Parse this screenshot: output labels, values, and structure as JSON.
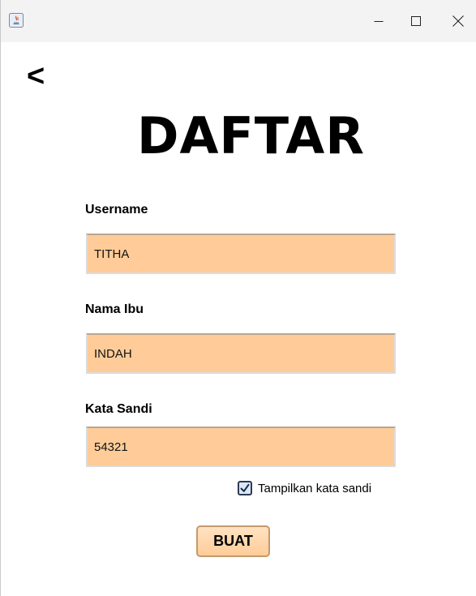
{
  "window": {
    "app_icon": "java-icon",
    "controls": {
      "minimize": "—",
      "maximize": "☐",
      "close": "✕"
    }
  },
  "nav": {
    "back_label": "<"
  },
  "title": "DAFTAR",
  "form": {
    "username": {
      "label": "Username",
      "value": "TITHA"
    },
    "mother_name": {
      "label": "Nama Ibu",
      "value": "INDAH"
    },
    "password": {
      "label": "Kata Sandi",
      "value": "54321"
    },
    "show_password": {
      "label": "Tampilkan kata sandi",
      "checked": true
    },
    "submit_label": "BUAT"
  },
  "colors": {
    "field_background": "#ffcc99",
    "title_bar": "#f3f3f3",
    "checkbox_border": "#2b3a55"
  }
}
